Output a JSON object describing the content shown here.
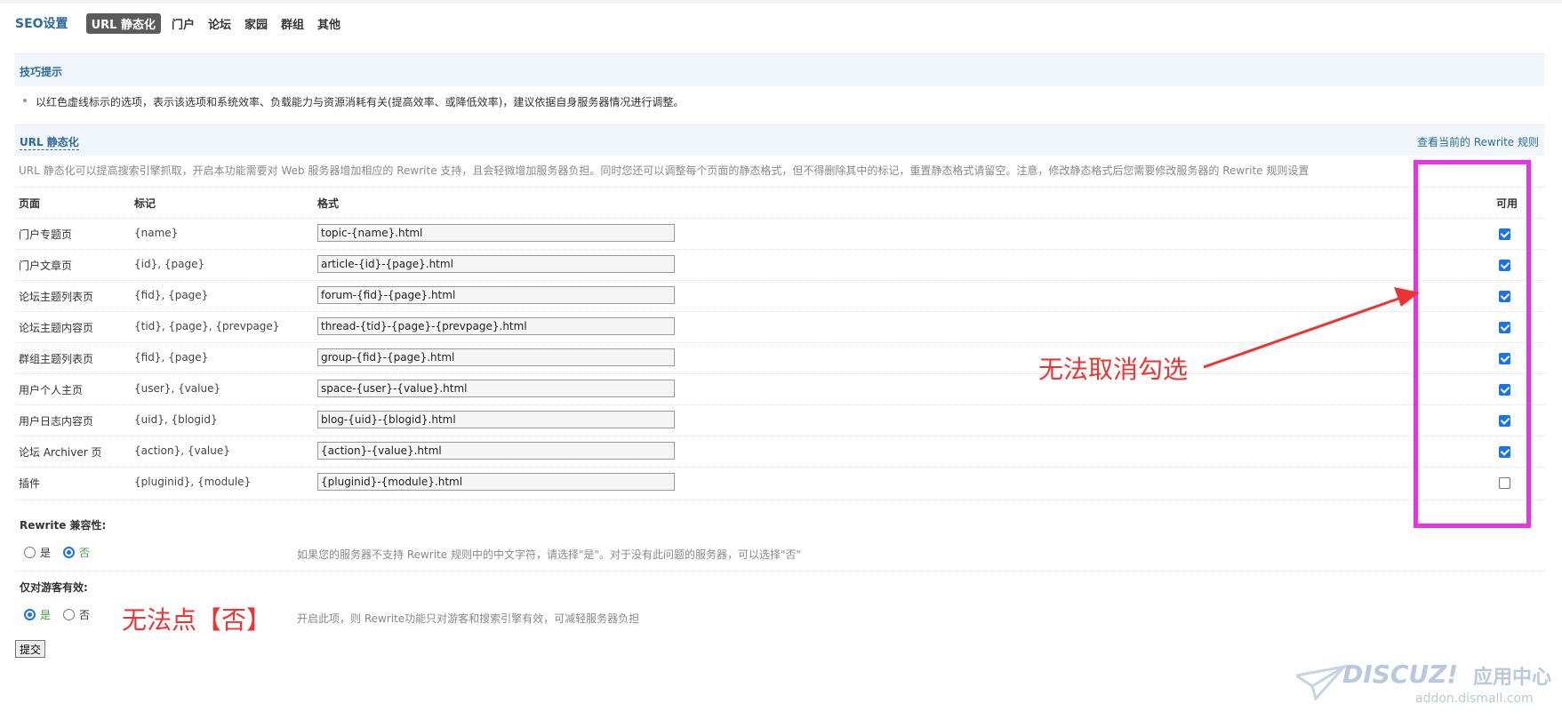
{
  "nav": {
    "title": "SEO设置",
    "tabs": [
      {
        "label": "URL 静态化",
        "active": true
      },
      {
        "label": "门户",
        "active": false
      },
      {
        "label": "论坛",
        "active": false
      },
      {
        "label": "家园",
        "active": false
      },
      {
        "label": "群组",
        "active": false
      },
      {
        "label": "其他",
        "active": false
      }
    ]
  },
  "tips": {
    "title": "技巧提示",
    "text": "以红色虚线标示的选项，表示该选项和系统效率、负载能力与资源消耗有关(提高效率、或降低效率)，建议依据自身服务器情况进行调整。"
  },
  "url_section": {
    "title": "URL 静态化",
    "rule_link": "查看当前的 Rewrite 规则",
    "description": "URL 静态化可以提高搜索引擎抓取，开启本功能需要对 Web 服务器增加相应的 Rewrite 支持，且会轻微增加服务器负担。同时您还可以调整每个页面的静态格式，但不得删除其中的标记，重置静态格式请留空。注意，修改静态格式后您需要修改服务器的 Rewrite 规则设置"
  },
  "table": {
    "headers": {
      "page": "页面",
      "mark": "标记",
      "format": "格式",
      "enabled": "可用"
    },
    "rows": [
      {
        "page": "门户专题页",
        "mark": "{name}",
        "format": "topic-{name}.html",
        "enabled": true
      },
      {
        "page": "门户文章页",
        "mark": "{id}, {page}",
        "format": "article-{id}-{page}.html",
        "enabled": true
      },
      {
        "page": "论坛主题列表页",
        "mark": "{fid}, {page}",
        "format": "forum-{fid}-{page}.html",
        "enabled": true
      },
      {
        "page": "论坛主题内容页",
        "mark": "{tid}, {page}, {prevpage}",
        "format": "thread-{tid}-{page}-{prevpage}.html",
        "enabled": true
      },
      {
        "page": "群组主题列表页",
        "mark": "{fid}, {page}",
        "format": "group-{fid}-{page}.html",
        "enabled": true
      },
      {
        "page": "用户个人主页",
        "mark": "{user}, {value}",
        "format": "space-{user}-{value}.html",
        "enabled": true
      },
      {
        "page": "用户日志内容页",
        "mark": "{uid}, {blogid}",
        "format": "blog-{uid}-{blogid}.html",
        "enabled": true
      },
      {
        "page": "论坛 Archiver 页",
        "mark": "{action}, {value}",
        "format": "{action}-{value}.html",
        "enabled": true
      },
      {
        "page": "插件",
        "mark": "{pluginid}, {module}",
        "format": "{pluginid}-{module}.html",
        "enabled": false
      }
    ]
  },
  "rewrite_compat": {
    "title": "Rewrite 兼容性:",
    "yes_label": "是",
    "no_label": "否",
    "selected": "no",
    "description": "如果您的服务器不支持 Rewrite 规则中的中文字符，请选择\"是\"。对于没有此问题的服务器，可以选择\"否\""
  },
  "guest_only": {
    "title": "仅对游客有效:",
    "yes_label": "是",
    "no_label": "否",
    "selected": "yes",
    "description": "开启此项，则 Rewrite功能只对游客和搜索引擎有效，可减轻服务器负担"
  },
  "submit_label": "提交",
  "annotations": {
    "checkbox_note": "无法取消勾选",
    "radio_note": "无法点【否】"
  },
  "watermark": {
    "brand": "DISCUZ!",
    "subtitle": "应用中心",
    "domain": "addon.dismall.com"
  },
  "colors": {
    "link": "#2b6a9b",
    "annotation": "#ee3333",
    "highlight_box": "#e633e6",
    "checkbox": "#1a73e8"
  }
}
